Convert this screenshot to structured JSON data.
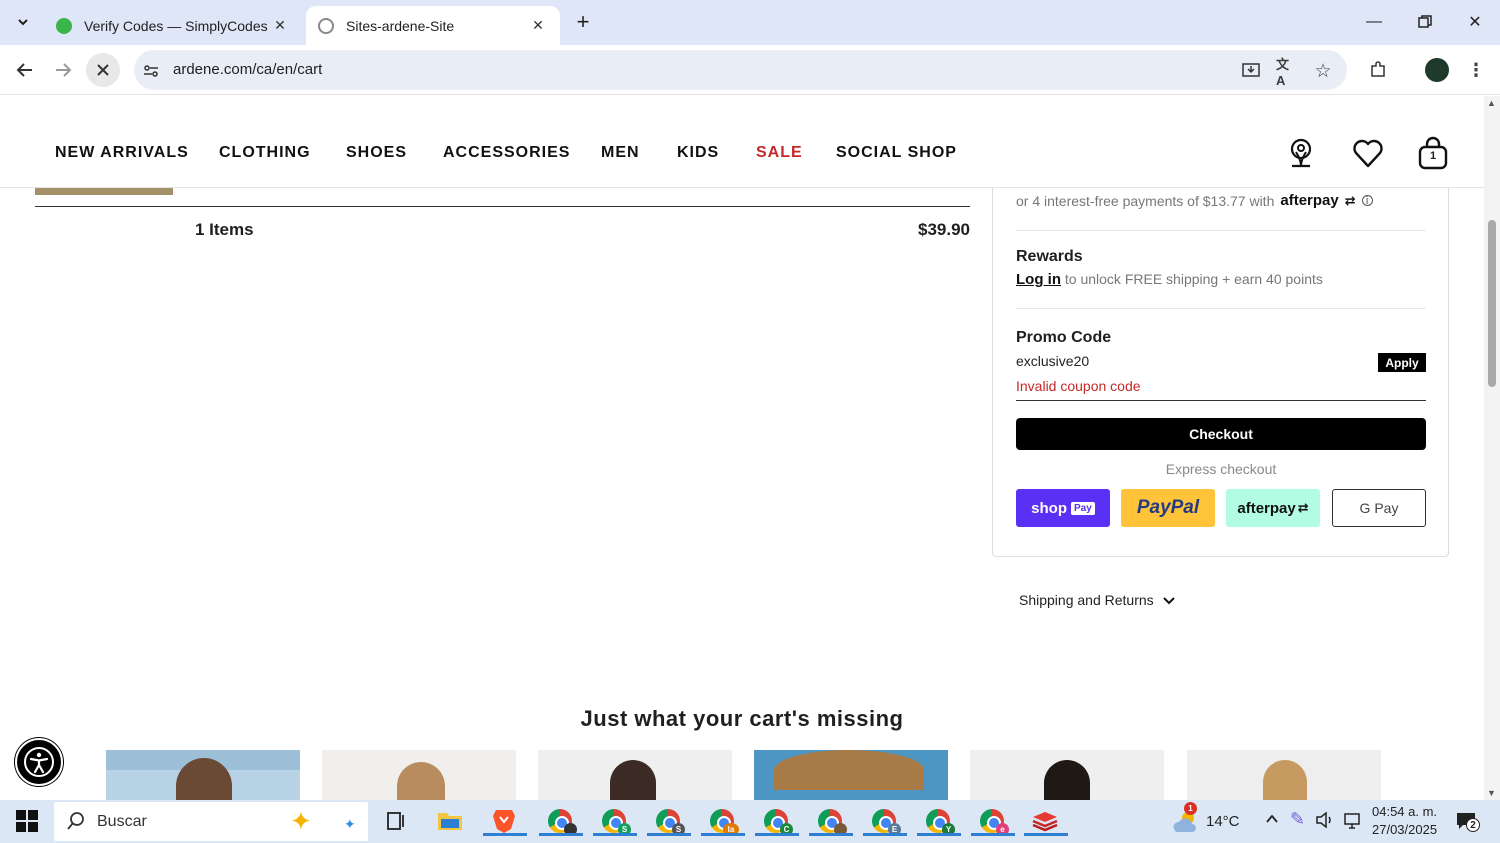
{
  "browser": {
    "tabs": [
      {
        "title": "Verify Codes — SimplyCodes",
        "active": false
      },
      {
        "title": "Sites-ardene-Site",
        "active": true
      }
    ],
    "url": "ardene.com/ca/en/cart"
  },
  "site_nav": {
    "items": [
      "NEW ARRIVALS",
      "CLOTHING",
      "SHOES",
      "ACCESSORIES",
      "MEN",
      "KIDS",
      "SALE",
      "SOCIAL SHOP"
    ],
    "cart_count": "1",
    "sale_color": "#c62828"
  },
  "cart": {
    "items_count": "1 Items",
    "total": "$39.90"
  },
  "summary": {
    "afterpay_text": "or 4 interest-free payments of $13.77 with",
    "afterpay_logo": "afterpay",
    "rewards_heading": "Rewards",
    "login_link": "Log in",
    "rewards_text": "to unlock FREE shipping + earn 40 points",
    "promo_heading": "Promo Code",
    "promo_value": "exclusive20",
    "apply_label": "Apply",
    "promo_error": "Invalid coupon code",
    "checkout_label": "Checkout",
    "express_label": "Express checkout",
    "pay_buttons": {
      "shop": "shop",
      "shop_pay": "Pay",
      "paypal": "PayPal",
      "afterpay": "afterpay",
      "gpay": "G Pay"
    }
  },
  "shipping_returns": "Shipping and Returns",
  "recommendations": {
    "title": "Just what your cart's missing"
  },
  "taskbar": {
    "search_placeholder": "Buscar",
    "temperature": "14°C",
    "weather_badge": "1",
    "time": "04:54 a. m.",
    "date": "27/03/2025",
    "notifications": "2",
    "app_badges": [
      "",
      "S",
      "S",
      "la",
      "C",
      "",
      "E",
      "Y",
      "e"
    ]
  }
}
